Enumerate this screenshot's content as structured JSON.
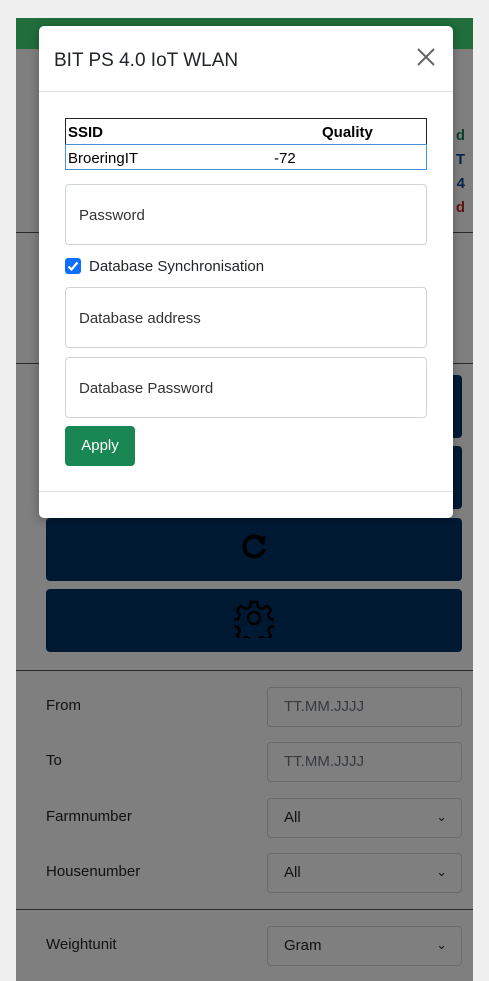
{
  "app": {
    "status_lines": [
      {
        "text": "d",
        "color": "#198754"
      },
      {
        "text": "T",
        "color": "#0d47a1"
      },
      {
        "text": "4",
        "color": "#0d47a1"
      },
      {
        "text": "d",
        "color": "#c62828"
      }
    ],
    "buttons": [
      {
        "name": "refresh-button",
        "icon": "refresh-icon"
      },
      {
        "name": "settings-button",
        "icon": "gear-icon"
      }
    ],
    "filters": {
      "from_label": "From",
      "from_placeholder": "TT.MM.JJJJ",
      "to_label": "To",
      "to_placeholder": "TT.MM.JJJJ",
      "farm_label": "Farmnumber",
      "farm_value": "All",
      "house_label": "Housenumber",
      "house_value": "All",
      "weight_label": "Weightunit",
      "weight_value": "Gram"
    }
  },
  "modal": {
    "title": "BIT PS 4.0 IoT WLAN",
    "table": {
      "headers": [
        "SSID",
        "Quality"
      ],
      "rows": [
        {
          "ssid": "BroeringIT",
          "quality": "-72"
        }
      ]
    },
    "password_placeholder": "Password",
    "db_sync_label": "Database Synchronisation",
    "db_sync_checked": true,
    "db_address_placeholder": "Database address",
    "db_password_placeholder": "Database Password",
    "apply_label": "Apply"
  },
  "colors": {
    "topbar": "#1f6e3b",
    "primary_button": "#003366",
    "apply_button": "#198754",
    "checkbox": "#0d6efd"
  }
}
